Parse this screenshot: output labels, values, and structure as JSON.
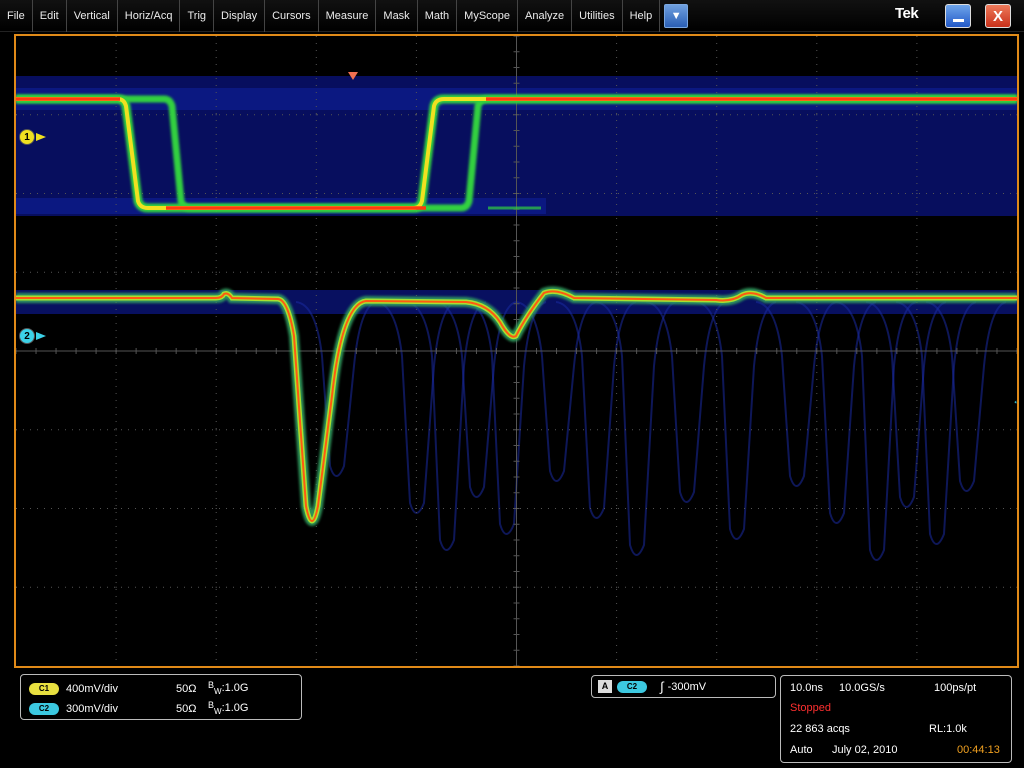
{
  "menu": {
    "items": [
      "File",
      "Edit",
      "Vertical",
      "Horiz/Acq",
      "Trig",
      "Display",
      "Cursors",
      "Measure",
      "Mask",
      "Math",
      "MyScope",
      "Analyze",
      "Utilities",
      "Help"
    ],
    "dropdown_icon": "▼"
  },
  "brand": "Tek",
  "window_controls": {
    "close_glyph": "X"
  },
  "markers": {
    "ch1": "1",
    "ch2": "2",
    "trigger_level_glyph": "←"
  },
  "channels": [
    {
      "badge": "C1",
      "volts_per_div": "400mV/div",
      "impedance": "50Ω",
      "bw_prefix": "B",
      "bw_sub": "W",
      "bw_value": ":1.0G",
      "color": "#e8e040"
    },
    {
      "badge": "C2",
      "volts_per_div": "300mV/div",
      "impedance": "50Ω",
      "bw_prefix": "B",
      "bw_sub": "W",
      "bw_value": ":1.0G",
      "color": "#3cc8e0"
    }
  ],
  "trigger": {
    "mode_badge": "A",
    "source": "C2",
    "slope_glyph": "∫",
    "level": "-300mV"
  },
  "acquisition": {
    "timebase": "10.0ns",
    "sample_rate": "10.0GS/s",
    "resolution": "100ps/pt",
    "state": "Stopped",
    "acq_count": "22 863 acqs",
    "record_length": "RL:1.0k",
    "trigger_mode": "Auto",
    "date": "July 02, 2010",
    "time": "00:44:13"
  },
  "colors": {
    "graticule_border": "#e08a18",
    "grid": "#555555",
    "persistence_blue": "#08106e",
    "trace_hot": "#ff3a10",
    "trace_warm": "#f0e020",
    "trace_mid": "#30d040",
    "state_stopped": "#ff3030",
    "clock": "#f0a020"
  }
}
